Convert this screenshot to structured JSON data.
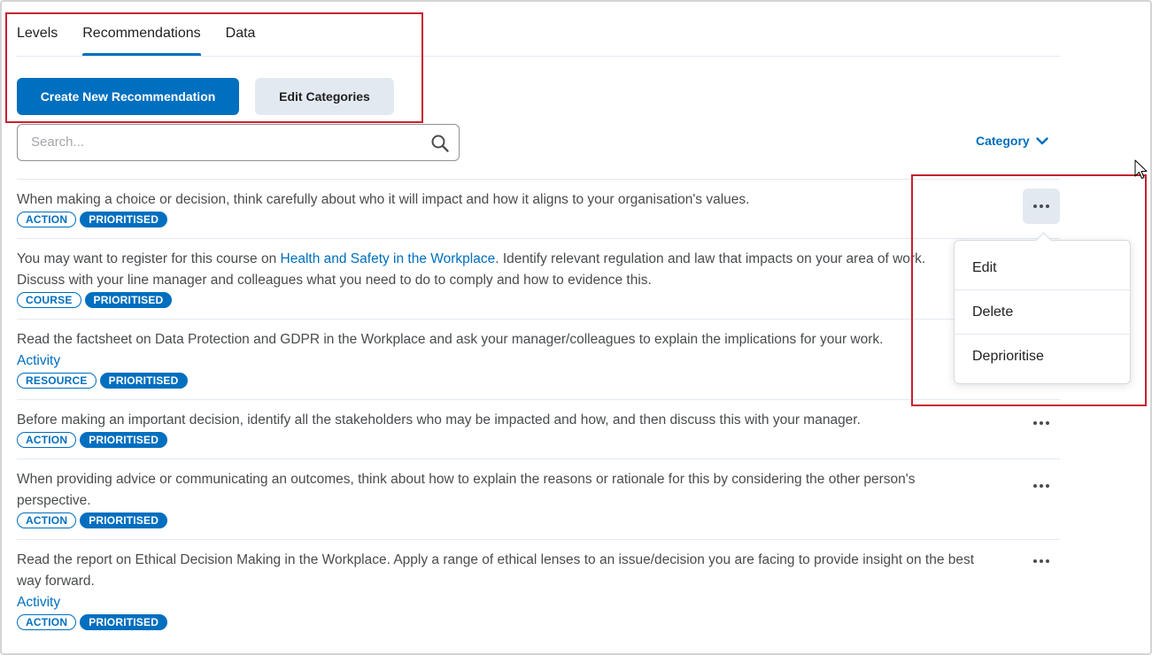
{
  "tabs": [
    {
      "label": "Levels",
      "active": false
    },
    {
      "label": "Recommendations",
      "active": true
    },
    {
      "label": "Data",
      "active": false
    }
  ],
  "buttons": {
    "create": "Create New Recommendation",
    "edit_categories": "Edit Categories"
  },
  "search": {
    "placeholder": "Search..."
  },
  "category_label": "Category",
  "items": [
    {
      "text": "When making a choice or decision, think carefully about who it will impact and how it aligns to your organisation's values.",
      "badges": [
        "ACTION",
        "PRIORITISED"
      ]
    },
    {
      "text_before": "You may want to register for this course on ",
      "link": "Health and Safety in the Workplace",
      "text_after": ". Identify relevant regulation and law that impacts on your area of work.",
      "text_line2": "Discuss with your line manager and colleagues what you need to do to comply and  how to evidence this.",
      "badges": [
        "COURSE",
        "PRIORITISED"
      ]
    },
    {
      "text": "Read the  factsheet on Data Protection and GDPR in the Workplace and ask your manager/colleagues to explain the implications for your work.",
      "activity": "Activity",
      "badges": [
        "RESOURCE",
        "PRIORITISED"
      ]
    },
    {
      "text": "Before making an important decision, identify all the stakeholders who may be impacted and how, and then discuss this with your manager.",
      "badges": [
        "ACTION",
        "PRIORITISED"
      ]
    },
    {
      "text": "When providing advice or communicating an outcomes, think about how to explain the reasons or rationale for this by considering the other person's perspective.",
      "badges": [
        "ACTION",
        "PRIORITISED"
      ]
    },
    {
      "text": "Read the  report on Ethical Decision Making in the Workplace. Apply a range of ethical lenses to an issue/decision you are facing to provide insight on the best way forward.",
      "activity": "Activity",
      "badges": [
        "ACTION",
        "PRIORITISED"
      ]
    }
  ],
  "menu": [
    "Edit",
    "Delete",
    "Deprioritise"
  ],
  "colors": {
    "primary": "#006fbf",
    "highlight_box": "#c8202f",
    "secondary_button": "#e3e9f1"
  }
}
